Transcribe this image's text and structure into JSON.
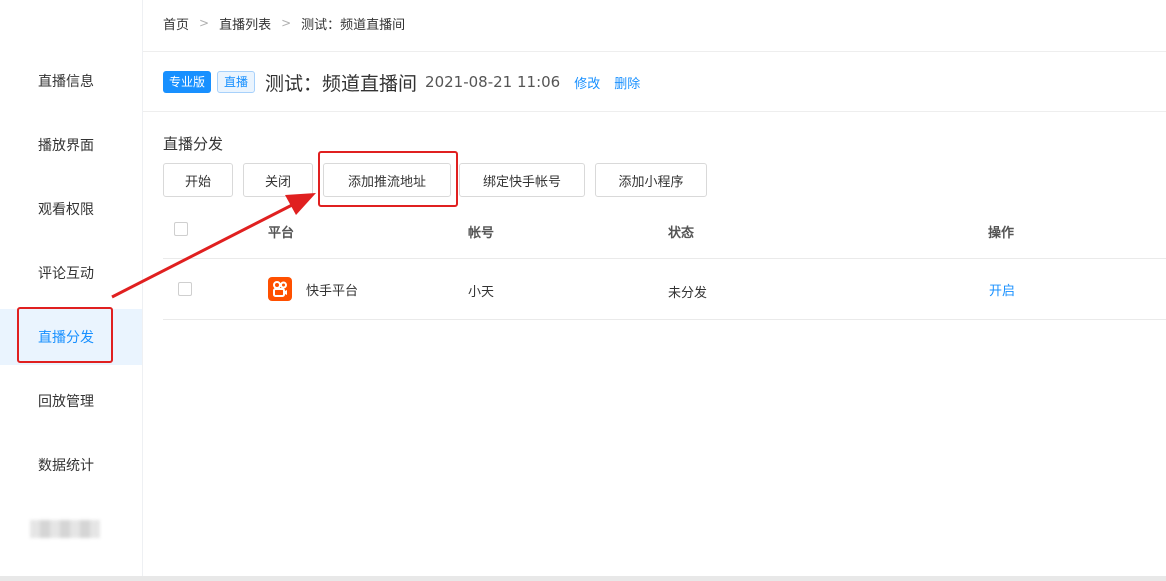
{
  "sidebar": {
    "items": [
      {
        "label": "直播信息"
      },
      {
        "label": "播放界面"
      },
      {
        "label": "观看权限"
      },
      {
        "label": "评论互动"
      },
      {
        "label": "直播分发",
        "active": true
      },
      {
        "label": "回放管理"
      },
      {
        "label": "数据统计"
      }
    ]
  },
  "breadcrumb": [
    "首页",
    "直播列表",
    "测试：频道直播间"
  ],
  "header": {
    "badge_pro": "专业版",
    "badge_live": "直播",
    "title": "测试：频道直播间",
    "time": "2021-08-21 11:06",
    "edit": "修改",
    "delete": "删除"
  },
  "section": {
    "title": "直播分发"
  },
  "toolbar": {
    "start": "开始",
    "close": "关闭",
    "add_push_url": "添加推流地址",
    "bind_kuaishou": "绑定快手帐号",
    "add_miniprogram": "添加小程序"
  },
  "table": {
    "columns": [
      "平台",
      "帐号",
      "状态",
      "操作"
    ],
    "rows": [
      {
        "platform": "快手平台",
        "account": "小天",
        "status": "未分发",
        "action": "开启",
        "icon": "kuaishou-icon"
      }
    ]
  },
  "colors": {
    "accent": "#1890ff",
    "annotation": "#e02020",
    "kuaishou": "#ff5000",
    "active_bg": "#eaf4fe"
  }
}
